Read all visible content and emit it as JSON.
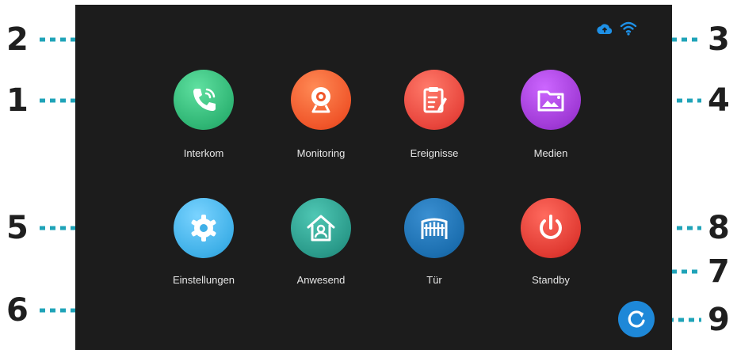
{
  "apps": [
    {
      "id": "interkom",
      "label": "Interkom",
      "icon": "phone-icon"
    },
    {
      "id": "monitoring",
      "label": "Monitoring",
      "icon": "camera-icon"
    },
    {
      "id": "ereignisse",
      "label": "Ereignisse",
      "icon": "clipboard-icon"
    },
    {
      "id": "medien",
      "label": "Medien",
      "icon": "media-folder-icon"
    },
    {
      "id": "einstellungen",
      "label": "Einstellungen",
      "icon": "gear-icon"
    },
    {
      "id": "anwesend",
      "label": "Anwesend",
      "icon": "home-person-icon"
    },
    {
      "id": "tuer",
      "label": "Tür",
      "icon": "gate-icon"
    },
    {
      "id": "standby",
      "label": "Standby",
      "icon": "power-icon"
    }
  ],
  "callouts": [
    "1",
    "2",
    "3",
    "4",
    "5",
    "6",
    "7",
    "8",
    "9"
  ],
  "status_icons": [
    "cloud-icon",
    "wifi-icon"
  ],
  "refresh_icon": "refresh-icon",
  "colors": {
    "screen_bg": "#1c1c1c",
    "callout_line": "#1fa3b8",
    "interkom": "#33c27a",
    "monitoring": "#f0562a",
    "ereignisse": "#e8453c",
    "medien": "#a03ad6",
    "einstellungen": "#3fb0e8",
    "anwesend": "#2a9a8a",
    "tuer": "#1c6fb0",
    "standby": "#e03a32",
    "status_icon": "#1e90e6"
  }
}
